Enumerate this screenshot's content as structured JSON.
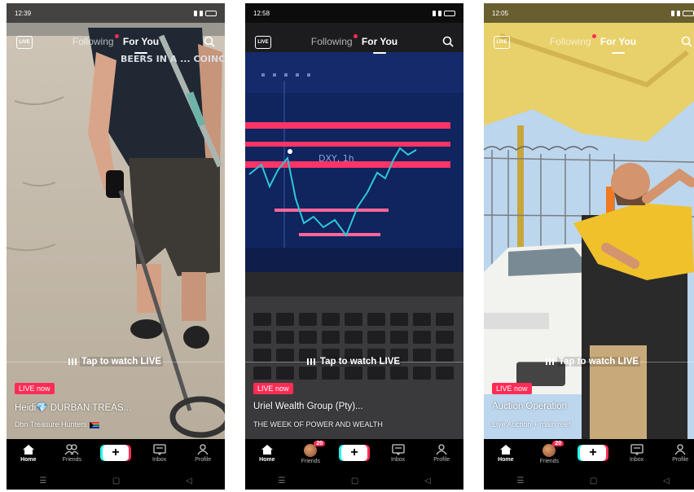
{
  "screens": [
    {
      "status_time": "12:39",
      "tab_following": "Following",
      "tab_for_you": "For You",
      "live_icon_label": "LIVE",
      "tap_to_watch": "Tap to watch LIVE",
      "live_badge": "LIVE now",
      "title": "Heidi💎 DURBAN TREAS...",
      "subtitle": "Dbn Treasure Hunters",
      "shirt_text": "BEERS IN A ... COINCIDEN...",
      "nav": {
        "home": "Home",
        "friends": "Friends",
        "inbox": "Inbox",
        "profile": "Profile"
      }
    },
    {
      "status_time": "12:58",
      "tab_following": "Following",
      "tab_for_you": "For You",
      "live_icon_label": "LIVE",
      "tap_to_watch": "Tap to watch LIVE",
      "live_badge": "LIVE now",
      "title": "Uriel Wealth Group (Pty)...",
      "subtitle": "THE WEEK OF POWER AND WEALTH",
      "chart_label": "DXY, 1h",
      "friends_badge": "20",
      "nav": {
        "home": "Home",
        "friends": "Friends",
        "inbox": "Inbox",
        "profile": "Profile"
      }
    },
    {
      "status_time": "12:05",
      "tab_following": "Following",
      "tab_for_you": "For You",
      "live_icon_label": "LIVE",
      "tap_to_watch": "Tap to watch LIVE",
      "live_badge": "LIVE now",
      "title": "Auction Operation",
      "subtitle": "Live Auction + main reef",
      "friends_badge": "20",
      "nav": {
        "home": "Home",
        "friends": "Friends",
        "inbox": "Inbox",
        "profile": "Profile"
      }
    }
  ],
  "colors": {
    "accent": "#fe2c55",
    "cyan": "#25f4ee",
    "chart_bg": "#1a3a8a",
    "chart_line": "#ff3366"
  }
}
